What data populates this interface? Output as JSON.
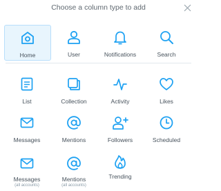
{
  "header": {
    "title": "Choose a column type to add"
  },
  "colors": {
    "accent": "#1da1f2",
    "selected_bg": "#e8f5fd",
    "text": "#47525c"
  },
  "tiles": [
    {
      "label": "Home",
      "icon": "home-icon",
      "selected": true
    },
    {
      "label": "User",
      "icon": "user-icon"
    },
    {
      "label": "Notifications",
      "icon": "bell-icon"
    },
    {
      "label": "Search",
      "icon": "search-icon"
    },
    {
      "label": "List",
      "icon": "list-icon"
    },
    {
      "label": "Collection",
      "icon": "collection-icon"
    },
    {
      "label": "Activity",
      "icon": "activity-icon"
    },
    {
      "label": "Likes",
      "icon": "heart-icon"
    },
    {
      "label": "Messages",
      "icon": "envelope-icon"
    },
    {
      "label": "Mentions",
      "icon": "at-icon"
    },
    {
      "label": "Followers",
      "icon": "add-user-icon"
    },
    {
      "label": "Scheduled",
      "icon": "clock-icon"
    },
    {
      "label": "Messages",
      "sublabel": "(all accounts)",
      "icon": "envelope-icon"
    },
    {
      "label": "Mentions",
      "sublabel": "(all accounts)",
      "icon": "at-icon"
    },
    {
      "label": "Trending",
      "icon": "flame-icon"
    }
  ]
}
